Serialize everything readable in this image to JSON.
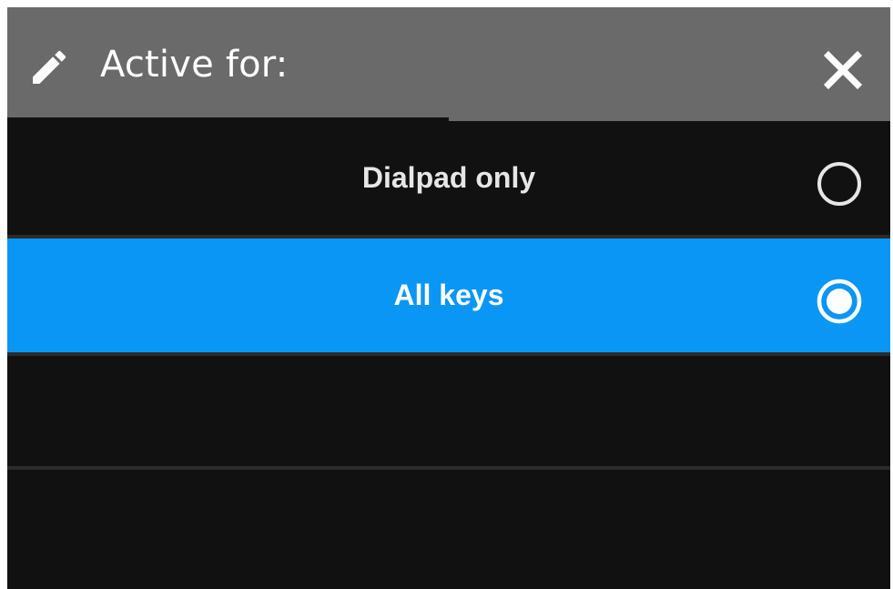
{
  "dialog": {
    "title": "Active for:",
    "edit_icon": "pencil-icon",
    "close_icon": "close-icon"
  },
  "options": [
    {
      "label": "Dialpad only",
      "selected": false
    },
    {
      "label": "All keys",
      "selected": true
    }
  ],
  "colors": {
    "header_bg": "#6a6a6a",
    "list_bg": "#111111",
    "selected_bg": "#0a96f5",
    "divider": "#2b2b2b"
  }
}
